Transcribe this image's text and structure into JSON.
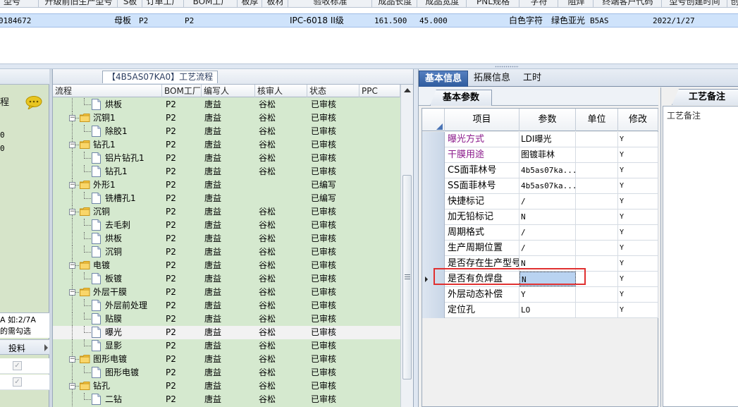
{
  "top_grid": {
    "headers": [
      "型号",
      "升级前旧生产型号",
      "S板",
      "订单工厂",
      "BOM工厂",
      "板厚",
      "板材",
      "验收标准",
      "成品长度",
      "成品宽度",
      "PNL规格",
      "字符",
      "阻焊",
      "终端客户代码",
      "型号创建时间",
      "创"
    ],
    "row": {
      "id": "0184672",
      "s_board": "母板",
      "order_factory": "P2",
      "bom_factory": "P2",
      "standard": "IPC-6018 II级",
      "length": "161.500",
      "width": "45.000",
      "char": "白色字符",
      "solder": "绿色亚光",
      "customer": "B5AS",
      "created": "2022/1/27"
    }
  },
  "left_panel": {
    "title": "程",
    "values": [
      "0",
      "0"
    ],
    "note_line1": "A 如:2/7A",
    "note_line2": "的需勾选",
    "sub_column": "投料"
  },
  "mid_panel": {
    "title": "【4B5AS07KA0】工艺流程",
    "headers": [
      "流程",
      "BOM工厂",
      "编写人",
      "核审人",
      "状态",
      "PPC"
    ],
    "rows": [
      {
        "name": "烘板",
        "level": 2,
        "factory": "P2",
        "writer": "唐益",
        "auditor": "谷松",
        "status": "已审核"
      },
      {
        "name": "沉铜1",
        "level": 1,
        "factory": "P2",
        "writer": "唐益",
        "auditor": "谷松",
        "status": "已审核"
      },
      {
        "name": "除胶1",
        "level": 2,
        "factory": "P2",
        "writer": "唐益",
        "auditor": "谷松",
        "status": "已审核"
      },
      {
        "name": "钻孔1",
        "level": 1,
        "factory": "P2",
        "writer": "唐益",
        "auditor": "谷松",
        "status": "已审核"
      },
      {
        "name": "铝片钻孔1",
        "level": 2,
        "factory": "P2",
        "writer": "唐益",
        "auditor": "谷松",
        "status": "已审核"
      },
      {
        "name": "钻孔1",
        "level": 2,
        "factory": "P2",
        "writer": "唐益",
        "auditor": "谷松",
        "status": "已审核"
      },
      {
        "name": "外形1",
        "level": 1,
        "factory": "P2",
        "writer": "唐益",
        "auditor": "",
        "status": "已编写"
      },
      {
        "name": "铣槽孔1",
        "level": 2,
        "factory": "P2",
        "writer": "唐益",
        "auditor": "",
        "status": "已编写"
      },
      {
        "name": "沉铜",
        "level": 1,
        "factory": "P2",
        "writer": "唐益",
        "auditor": "谷松",
        "status": "已审核"
      },
      {
        "name": "去毛刺",
        "level": 2,
        "factory": "P2",
        "writer": "唐益",
        "auditor": "谷松",
        "status": "已审核"
      },
      {
        "name": "烘板",
        "level": 2,
        "factory": "P2",
        "writer": "唐益",
        "auditor": "谷松",
        "status": "已审核"
      },
      {
        "name": "沉铜",
        "level": 2,
        "factory": "P2",
        "writer": "唐益",
        "auditor": "谷松",
        "status": "已审核"
      },
      {
        "name": "电镀",
        "level": 1,
        "factory": "P2",
        "writer": "唐益",
        "auditor": "谷松",
        "status": "已审核"
      },
      {
        "name": "板镀",
        "level": 2,
        "factory": "P2",
        "writer": "唐益",
        "auditor": "谷松",
        "status": "已审核"
      },
      {
        "name": "外层干膜",
        "level": 1,
        "factory": "P2",
        "writer": "唐益",
        "auditor": "谷松",
        "status": "已审核"
      },
      {
        "name": "外层前处理",
        "level": 2,
        "factory": "P2",
        "writer": "唐益",
        "auditor": "谷松",
        "status": "已审核"
      },
      {
        "name": "贴膜",
        "level": 2,
        "factory": "P2",
        "writer": "唐益",
        "auditor": "谷松",
        "status": "已审核"
      },
      {
        "name": "曝光",
        "level": 2,
        "factory": "P2",
        "writer": "唐益",
        "auditor": "谷松",
        "status": "已审核",
        "selected": true
      },
      {
        "name": "显影",
        "level": 2,
        "factory": "P2",
        "writer": "唐益",
        "auditor": "谷松",
        "status": "已审核"
      },
      {
        "name": "图形电镀",
        "level": 1,
        "factory": "P2",
        "writer": "唐益",
        "auditor": "谷松",
        "status": "已审核"
      },
      {
        "name": "图形电镀",
        "level": 2,
        "factory": "P2",
        "writer": "唐益",
        "auditor": "谷松",
        "status": "已审核"
      },
      {
        "name": "钻孔",
        "level": 1,
        "factory": "P2",
        "writer": "唐益",
        "auditor": "谷松",
        "status": "已审核"
      },
      {
        "name": "二钻",
        "level": 2,
        "factory": "P2",
        "writer": "唐益",
        "auditor": "谷松",
        "status": "已审核"
      }
    ]
  },
  "right_panel": {
    "tabs": [
      "基本信息",
      "拓展信息",
      "工时"
    ],
    "active_tab": 0,
    "sub_tab": "基本参数",
    "grid_headers": [
      "项目",
      "参数",
      "单位",
      "修改"
    ],
    "rows": [
      {
        "item": "曝光方式",
        "param": "LDI曝光",
        "unit": "",
        "mod": "Y",
        "color": "#8b1a8b"
      },
      {
        "item": "干膜用途",
        "param": "图镀菲林",
        "unit": "",
        "mod": "Y",
        "color": "#8b1a8b"
      },
      {
        "item": "CS面菲林号",
        "param": "4b5as07ka...",
        "unit": "",
        "mod": "Y"
      },
      {
        "item": "SS面菲林号",
        "param": "4b5as07ka...",
        "unit": "",
        "mod": "Y"
      },
      {
        "item": "快捷标记",
        "param": "/",
        "unit": "",
        "mod": "Y"
      },
      {
        "item": "加无铅标记",
        "param": "N",
        "unit": "",
        "mod": "Y"
      },
      {
        "item": "周期格式",
        "param": "/",
        "unit": "",
        "mod": "Y"
      },
      {
        "item": "生产周期位置",
        "param": "/",
        "unit": "",
        "mod": "Y"
      },
      {
        "item": "是否存在生产型号",
        "param": "N",
        "unit": "",
        "mod": "Y"
      },
      {
        "item": "是否有负焊盘",
        "param": "N",
        "unit": "",
        "mod": "Y",
        "current": true
      },
      {
        "item": "外层动态补偿",
        "param": "Y",
        "unit": "",
        "mod": "Y"
      },
      {
        "item": "定位孔",
        "param": "LO",
        "unit": "",
        "mod": "Y"
      }
    ],
    "remarks_tab": "工艺备注",
    "remarks_label": "工艺备注"
  }
}
